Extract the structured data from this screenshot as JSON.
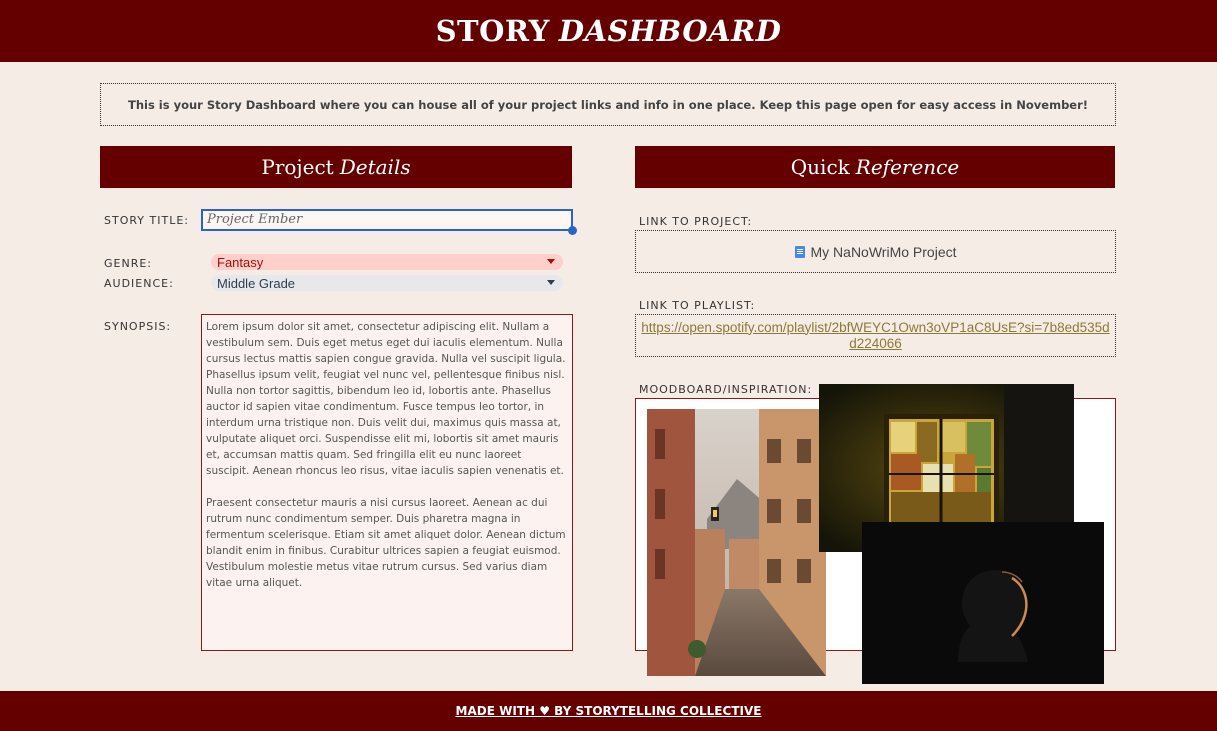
{
  "header": {
    "title_main": "STORY",
    "title_em": "DASHBOARD"
  },
  "intro": "This is your Story Dashboard where you can house all of your project links and info in one place. Keep this page open for easy access in November!",
  "details": {
    "heading_main": "Project",
    "heading_em": "Details",
    "story_title_label": "STORY TITLE:",
    "story_title_value": "Project Ember",
    "genre_label": "GENRE:",
    "genre_value": "Fantasy",
    "audience_label": "AUDIENCE:",
    "audience_value": "Middle Grade",
    "synopsis_label": "SYNOPSIS:",
    "synopsis_p1": "Lorem ipsum dolor sit amet, consectetur adipiscing elit. Nullam a vestibulum sem. Duis eget metus eget dui iaculis elementum. Nulla cursus lectus mattis sapien congue gravida. Nulla vel suscipit ligula. Phasellus ipsum velit, feugiat vel nunc vel, pellentesque finibus nisl. Nulla non tortor sagittis, bibendum leo id, lobortis ante. Phasellus auctor id sapien vitae condimentum. Fusce tempus leo tortor, in interdum urna tristique non. Duis velit dui, maximus quis massa at, vulputate aliquet orci. Suspendisse elit mi, lobortis sit amet mauris et, accumsan mattis quam. Sed fringilla elit eu nunc laoreet suscipit. Aenean rhoncus leo risus, vitae iaculis sapien venenatis et.",
    "synopsis_p2": "Praesent consectetur mauris a nisi cursus laoreet. Aenean ac dui rutrum nunc condimentum semper. Duis pharetra magna in fermentum scelerisque. Etiam sit amet aliquet dolor. Aenean dictum blandit enim in finibus. Curabitur ultrices sapien a feugiat euismod. Vestibulum molestie metus vitae rutrum cursus. Sed varius diam vitae urna aliquet."
  },
  "reference": {
    "heading_main": "Quick",
    "heading_em": "Reference",
    "project_link_label": "LINK TO PROJECT:",
    "project_link_text": "My NaNoWriMo Project",
    "playlist_label": "LINK TO PLAYLIST:",
    "playlist_url": "https://open.spotify.com/playlist/2bfWEYC1Own3oVP1aC8UsE?si=7b8ed535dd224066",
    "moodboard_label": "MOODBOARD/INSPIRATION:"
  },
  "footer": "MADE WITH ♥ BY STORYTELLING COLLECTIVE",
  "colors": {
    "brand": "#650000",
    "background": "#f6ece6",
    "genre_chip": "#ffcfc9",
    "audience_chip": "#e8e8ec",
    "link_blue": "#2a64c5"
  }
}
